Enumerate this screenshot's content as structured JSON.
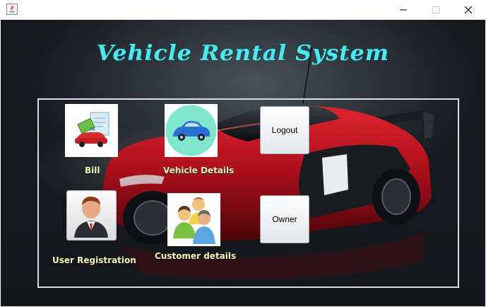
{
  "window": {
    "controls": {
      "minimize_icon": "minimize-icon",
      "maximize_icon": "maximize-icon",
      "close_icon": "close-icon"
    }
  },
  "main": {
    "title": "Vehicle Rental System",
    "items": [
      {
        "label": "Bill",
        "icon": "bill-car-icon"
      },
      {
        "label": "Vehicle Details",
        "icon": "car-icon"
      },
      {
        "label": "User Registration",
        "icon": "user-icon"
      },
      {
        "label": "Customer details",
        "icon": "customers-icon"
      }
    ],
    "buttons": {
      "logout": "Logout",
      "owner": "Owner"
    }
  },
  "colors": {
    "title": "#4de8ef",
    "labels": "#f3f6b8",
    "frame": "#d9dde2",
    "car_body": "#b0101c"
  }
}
